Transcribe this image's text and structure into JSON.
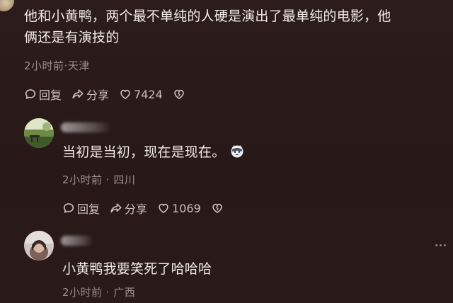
{
  "comment1": {
    "line1": "他和小黄鸭，两个最不单纯的人硬是演出了最单纯的电影，他",
    "line2": "俩还是有演技的",
    "meta": "2小时前·天津",
    "reply_label": "回复",
    "share_label": "分享",
    "like_count": "7424"
  },
  "comment2": {
    "text": "当初是当初，现在是现在。",
    "meta": "2小时前 · 四川",
    "reply_label": "回复",
    "share_label": "分享",
    "like_count": "1069"
  },
  "comment3": {
    "text": "小黄鸭我要笑死了哈哈哈",
    "meta": "2小时前 · 广西"
  },
  "colors": {
    "background": "#2a1b1a",
    "text": "#f1ebe8",
    "meta": "#9b8f8c",
    "icon": "#c9c1bf"
  },
  "icons": [
    "comment-bubble-icon",
    "share-arrow-icon",
    "heart-icon",
    "broken-heart-icon",
    "emoji-sticker-icon",
    "more-dots-icon"
  ]
}
